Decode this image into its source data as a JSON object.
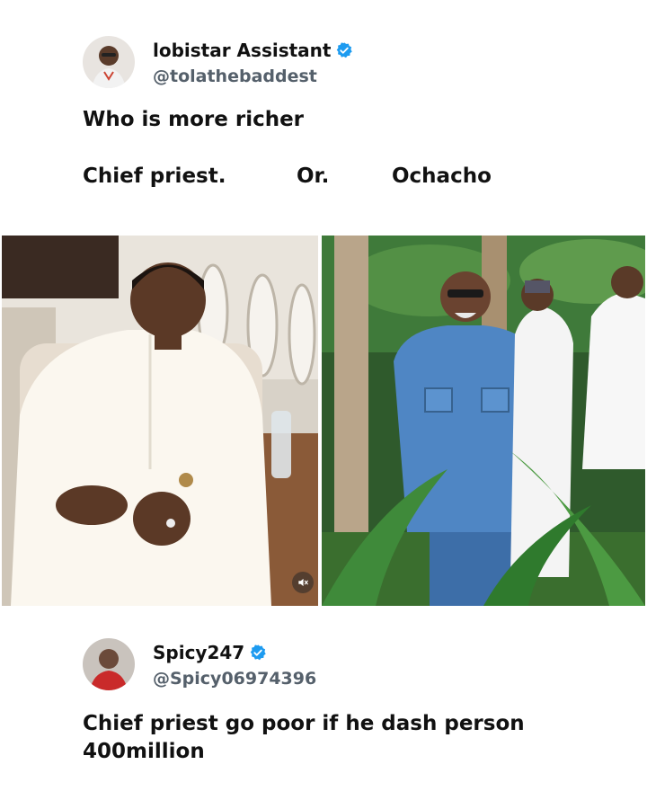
{
  "post": {
    "author": {
      "name": "lobistar Assistant",
      "handle": "@tolathebaddest",
      "verified": true
    },
    "question": "Who is more richer",
    "choices": [
      "Chief priest.",
      "Or.",
      "Ochacho"
    ]
  },
  "reply": {
    "author": {
      "name": "Spicy247",
      "handle": "@Spicy06974396",
      "verified": true
    },
    "text": " Chief priest go poor if he dash person 400million"
  },
  "media": {
    "icons": [
      "mute-icon",
      "verified-icon"
    ]
  },
  "colors": {
    "verified_blue": "#1d9bf0",
    "handle_gray": "#55606b"
  }
}
